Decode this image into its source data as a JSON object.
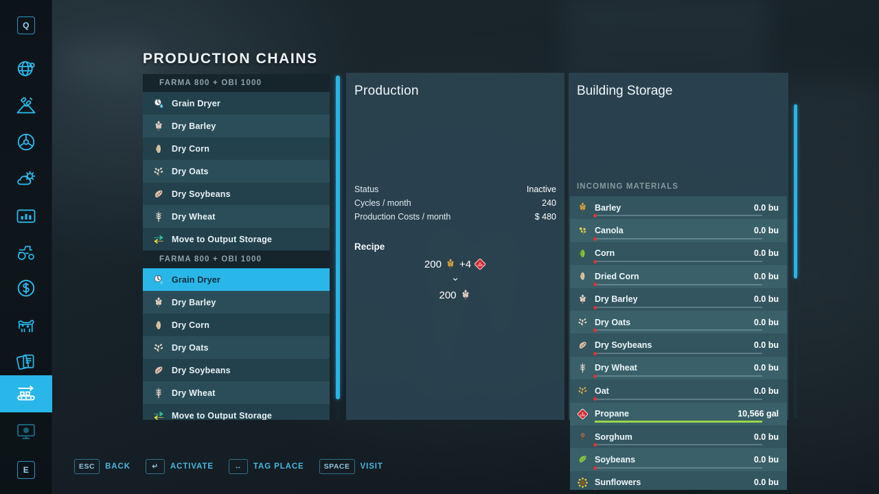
{
  "page": {
    "title": "PRODUCTION CHAINS"
  },
  "sidebar": {
    "accent": "#29b6e8",
    "items": [
      {
        "name": "key-q",
        "icon": "keycap-q",
        "label": "Q",
        "active": false
      },
      {
        "name": "map-overview",
        "icon": "globe-icon",
        "label": "Map",
        "active": false
      },
      {
        "name": "terrain",
        "icon": "satellite-icon",
        "label": "Satellite",
        "active": false
      },
      {
        "name": "vehicles",
        "icon": "steering-wheel-icon",
        "label": "Steering",
        "active": false
      },
      {
        "name": "weather",
        "icon": "weather-icon",
        "label": "Weather",
        "active": false
      },
      {
        "name": "statistics",
        "icon": "chart-icon",
        "label": "Statistics",
        "active": false
      },
      {
        "name": "machines",
        "icon": "tractor-icon",
        "label": "Vehicles",
        "active": false
      },
      {
        "name": "finances",
        "icon": "dollar-icon",
        "label": "Finances",
        "active": false
      },
      {
        "name": "animals",
        "icon": "cow-icon",
        "label": "Animals",
        "active": false
      },
      {
        "name": "contracts",
        "icon": "documents-icon",
        "label": "Contracts",
        "active": false
      },
      {
        "name": "production",
        "icon": "conveyor-icon",
        "label": "Production",
        "active": true
      },
      {
        "name": "radio",
        "icon": "monitor-icon",
        "label": "Monitor",
        "active": false
      },
      {
        "name": "key-e",
        "icon": "keycap-e",
        "label": "E",
        "active": false
      }
    ]
  },
  "chain_list": {
    "scroll_thumb_pct": 94,
    "rows": [
      {
        "type": "group",
        "label": "FARMA 800 + OBI 1000"
      },
      {
        "type": "item",
        "label": "Grain Dryer",
        "icon": "grain-dryer-icon",
        "selected": false
      },
      {
        "type": "item",
        "label": "Dry Barley",
        "icon": "barley-dry-icon",
        "selected": false
      },
      {
        "type": "item",
        "label": "Dry Corn",
        "icon": "corn-dry-icon",
        "selected": false
      },
      {
        "type": "item",
        "label": "Dry Oats",
        "icon": "oat-dry-icon",
        "selected": false
      },
      {
        "type": "item",
        "label": "Dry Soybeans",
        "icon": "soybean-dry-icon",
        "selected": false
      },
      {
        "type": "item",
        "label": "Dry Wheat",
        "icon": "wheat-dry-icon",
        "selected": false
      },
      {
        "type": "item",
        "label": "Move to Output Storage",
        "icon": "move-arrows-icon",
        "selected": false
      },
      {
        "type": "group",
        "label": "FARMA 800 + OBI 1000"
      },
      {
        "type": "item",
        "label": "Grain Dryer",
        "icon": "grain-dryer-icon",
        "selected": true
      },
      {
        "type": "item",
        "label": "Dry Barley",
        "icon": "barley-dry-icon",
        "selected": false
      },
      {
        "type": "item",
        "label": "Dry Corn",
        "icon": "corn-dry-icon",
        "selected": false
      },
      {
        "type": "item",
        "label": "Dry Oats",
        "icon": "oat-dry-icon",
        "selected": false
      },
      {
        "type": "item",
        "label": "Dry Soybeans",
        "icon": "soybean-dry-icon",
        "selected": false
      },
      {
        "type": "item",
        "label": "Dry Wheat",
        "icon": "wheat-dry-icon",
        "selected": false
      },
      {
        "type": "item",
        "label": "Move to Output Storage",
        "icon": "move-arrows-icon",
        "selected": false
      }
    ]
  },
  "production": {
    "title": "Production",
    "stats": [
      {
        "label": "Status",
        "value": "Inactive"
      },
      {
        "label": "Cycles / month",
        "value": "240"
      },
      {
        "label": "Production Costs / month",
        "value": "$ 480"
      }
    ],
    "recipe_label": "Recipe",
    "recipe": {
      "inputs": [
        {
          "amount": "200",
          "icon": "barley-icon"
        },
        {
          "amount": "+4",
          "icon": "propane-icon"
        }
      ],
      "arrow": "⌄",
      "outputs": [
        {
          "amount": "200",
          "icon": "barley-dry-icon"
        }
      ]
    }
  },
  "storage": {
    "title": "Building Storage",
    "section_label": "INCOMING MATERIALS",
    "scroll_thumb_pct": 55,
    "items": [
      {
        "name": "Barley",
        "amount": "0.0 bu",
        "fill_pct": 0,
        "icon": "barley-icon"
      },
      {
        "name": "Canola",
        "amount": "0.0 bu",
        "fill_pct": 0,
        "icon": "canola-icon"
      },
      {
        "name": "Corn",
        "amount": "0.0 bu",
        "fill_pct": 0,
        "icon": "corn-icon"
      },
      {
        "name": "Dried Corn",
        "amount": "0.0 bu",
        "fill_pct": 0,
        "icon": "corn-dry-icon"
      },
      {
        "name": "Dry Barley",
        "amount": "0.0 bu",
        "fill_pct": 0,
        "icon": "barley-dry-icon"
      },
      {
        "name": "Dry Oats",
        "amount": "0.0 bu",
        "fill_pct": 0,
        "icon": "oat-dry-icon"
      },
      {
        "name": "Dry Soybeans",
        "amount": "0.0 bu",
        "fill_pct": 0,
        "icon": "soybean-dry-icon"
      },
      {
        "name": "Dry Wheat",
        "amount": "0.0 bu",
        "fill_pct": 0,
        "icon": "wheat-dry-icon"
      },
      {
        "name": "Oat",
        "amount": "0.0 bu",
        "fill_pct": 0,
        "icon": "oat-icon"
      },
      {
        "name": "Propane",
        "amount": "10,566 gal",
        "fill_pct": 100,
        "icon": "propane-icon"
      },
      {
        "name": "Sorghum",
        "amount": "0.0 bu",
        "fill_pct": 0,
        "icon": "sorghum-icon"
      },
      {
        "name": "Soybeans",
        "amount": "0.0 bu",
        "fill_pct": 0,
        "icon": "soybean-icon"
      },
      {
        "name": "Sunflowers",
        "amount": "0.0 bu",
        "fill_pct": 0,
        "icon": "sunflower-icon"
      }
    ]
  },
  "footer": {
    "hints": [
      {
        "key": "ESC",
        "label": "BACK"
      },
      {
        "key": "↵",
        "label": "ACTIVATE"
      },
      {
        "key": "↔",
        "label": "TAG PLACE"
      },
      {
        "key": "SPACE",
        "label": "VISIT"
      }
    ]
  },
  "colors": {
    "accent": "#29b6e8",
    "panel": "#2a4350",
    "row": "#32555f",
    "row_alt": "#3a6069",
    "bar_fill": "#9ad648",
    "bar_dot": "#e0342e"
  }
}
